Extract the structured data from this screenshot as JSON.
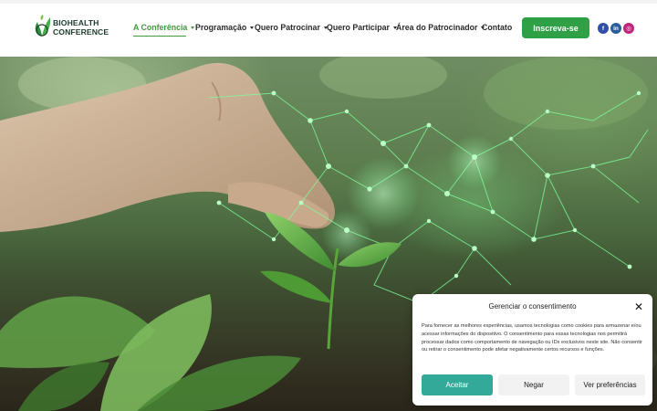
{
  "brand": {
    "line1": "BIOHEALTH",
    "line2": "CONFERENCE"
  },
  "nav": {
    "items": [
      {
        "label": "A Conferência",
        "dropdown": true,
        "active": true
      },
      {
        "label": "Programação",
        "dropdown": true
      },
      {
        "label": "Quero Patrocinar",
        "dropdown": true
      },
      {
        "label": "Quero Participar",
        "dropdown": true
      },
      {
        "label": "Área do Patrocinador",
        "dropdown": true
      },
      {
        "label": "Contato",
        "dropdown": false
      }
    ],
    "cta_label": "Inscreva-se"
  },
  "social": [
    {
      "icon": "facebook-icon",
      "glyph": "f"
    },
    {
      "icon": "linkedin-icon",
      "glyph": "in"
    },
    {
      "icon": "instagram-icon",
      "glyph": "◎"
    }
  ],
  "hero": {
    "image": "hand-planting-seedling-with-network-overlay"
  },
  "consent": {
    "title": "Gerenciar o consentimento",
    "body": "Para fornecer as melhores experiências, usamos tecnologias como cookies para armazenar e/ou acessar informações do dispositivo. O consentimento para essas tecnologias nos permitirá processar dados como comportamento de navegação ou IDs exclusivos neste site. Não consentir ou retirar o consentimento pode afetar negativamente certos recursos e funções.",
    "accept_label": "Aceitar",
    "deny_label": "Negar",
    "prefs_label": "Ver preferências"
  },
  "colors": {
    "brand_green": "#2fa046",
    "active_nav": "#3e9a3a",
    "accept_teal": "#33a99a",
    "text_dark": "#2b2b2b"
  }
}
